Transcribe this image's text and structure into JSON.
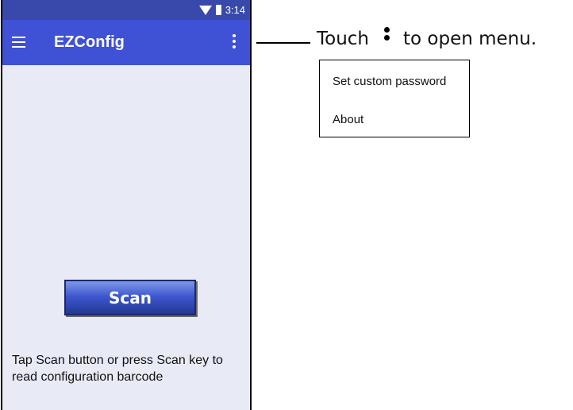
{
  "status_bar": {
    "time": "3:14"
  },
  "app_bar": {
    "title": "EZConfig"
  },
  "main": {
    "scan_button_label": "Scan",
    "instructions": "Tap Scan button or press Scan key to read configuration barcode"
  },
  "callout": {
    "touch": "Touch",
    "rest": "to open menu."
  },
  "menu": {
    "items": [
      "Set custom password",
      "About"
    ]
  },
  "icons": {
    "status": [
      "wifi-icon",
      "battery-icon"
    ],
    "app_bar": [
      "hamburger-menu-icon",
      "overflow-menu-icon"
    ]
  },
  "colors": {
    "app_bar": "#3f51d5",
    "status_bar": "#3949ab",
    "background": "#e8eaf6",
    "scan_button": "#3b56cf"
  }
}
